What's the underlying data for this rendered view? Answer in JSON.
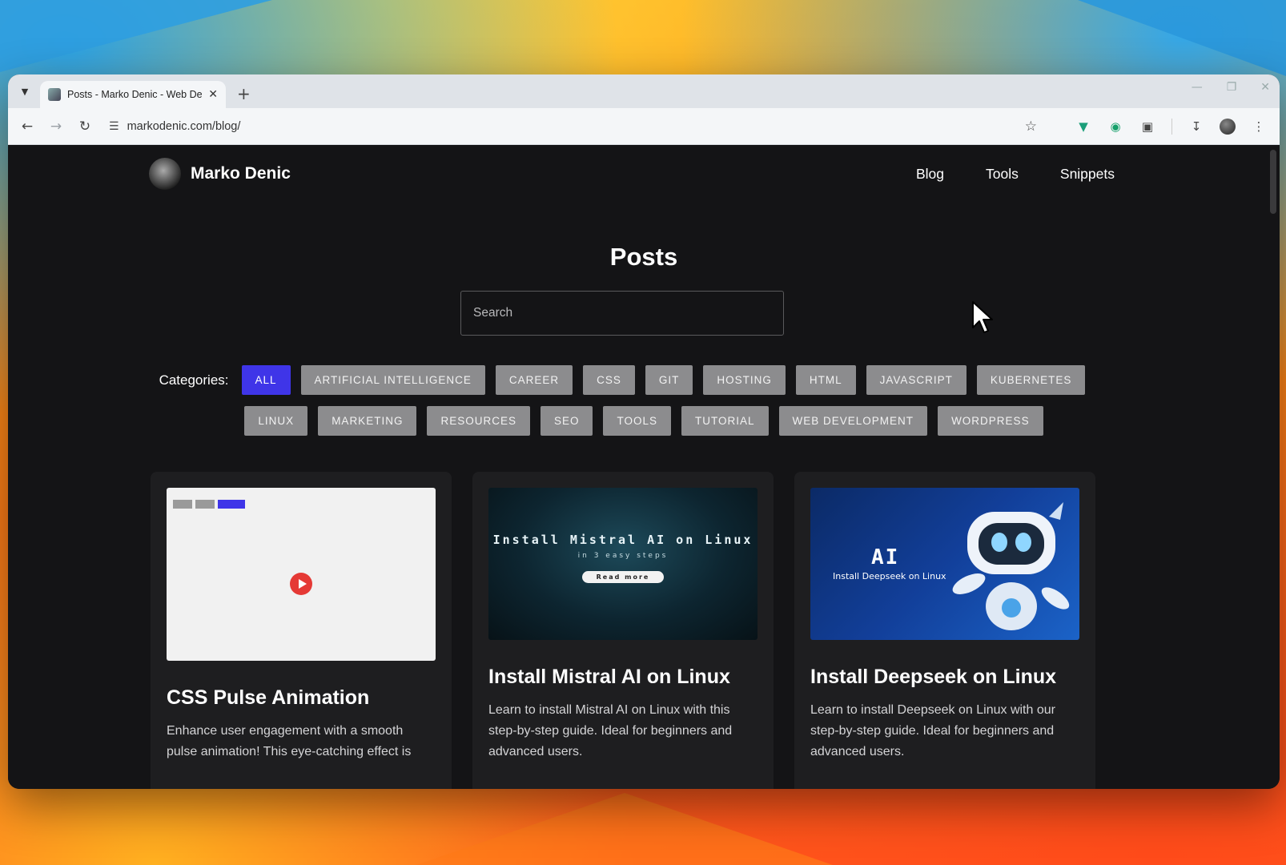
{
  "browser": {
    "tab_title": "Posts - Marko Denic - Web Dev",
    "url": "markodenic.com/blog/"
  },
  "site": {
    "brand": "Marko Denic",
    "nav": [
      "Blog",
      "Tools",
      "Snippets"
    ]
  },
  "page": {
    "title": "Posts",
    "search_placeholder": "Search",
    "categories_label": "Categories:",
    "categories_row1": [
      "ALL",
      "ARTIFICIAL INTELLIGENCE",
      "CAREER",
      "CSS",
      "GIT",
      "HOSTING",
      "HTML",
      "JAVASCRIPT",
      "KUBERNETES"
    ],
    "categories_row2": [
      "LINUX",
      "MARKETING",
      "RESOURCES",
      "SEO",
      "TOOLS",
      "TUTORIAL",
      "WEB DEVELOPMENT",
      "WORDPRESS"
    ],
    "active_category": "ALL"
  },
  "posts": [
    {
      "title": "CSS Pulse Animation",
      "description": "Enhance user engagement with a smooth pulse animation! This eye-catching effect is",
      "thumb": "white"
    },
    {
      "title": "Install Mistral AI on Linux",
      "description": "Learn to install Mistral AI on Linux with this step-by-step guide. Ideal for beginners and advanced users.",
      "thumb": "mistral",
      "thumb_title": "Install Mistral AI on Linux",
      "thumb_subtitle": "in 3 easy steps",
      "thumb_button": "Read more"
    },
    {
      "title": "Install Deepseek on Linux",
      "description": "Learn to install Deepseek on Linux with our step-by-step guide. Ideal for beginners and advanced users.",
      "thumb": "deep",
      "thumb_title": "AI",
      "thumb_subtitle": "Install Deepseek on Linux"
    }
  ],
  "colors": {
    "active_chip": "#3f35e8",
    "chip": "#8c8c8e",
    "page_bg": "#141416",
    "card_bg": "#1e1e20"
  }
}
